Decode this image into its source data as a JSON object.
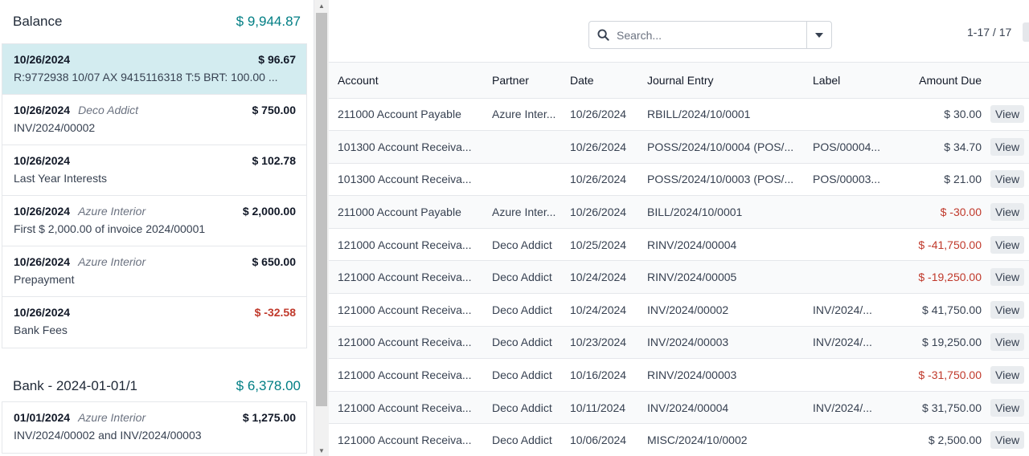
{
  "balance_group": {
    "title": "Balance",
    "amount": "$ 9,944.87"
  },
  "balance_lines": [
    {
      "date": "10/26/2024",
      "partner": "",
      "amount": "$ 96.67",
      "label": "R:9772938 10/07 AX 9415116318 T:5 BRT: 100.00 ...",
      "negative": false,
      "selected": true
    },
    {
      "date": "10/26/2024",
      "partner": "Deco Addict",
      "amount": "$ 750.00",
      "label": "INV/2024/00002",
      "negative": false
    },
    {
      "date": "10/26/2024",
      "partner": "",
      "amount": "$ 102.78",
      "label": "Last Year Interests",
      "negative": false
    },
    {
      "date": "10/26/2024",
      "partner": "Azure Interior",
      "amount": "$ 2,000.00",
      "label": "First $ 2,000.00 of invoice 2024/00001",
      "negative": false
    },
    {
      "date": "10/26/2024",
      "partner": "Azure Interior",
      "amount": "$ 650.00",
      "label": "Prepayment",
      "negative": false
    },
    {
      "date": "10/26/2024",
      "partner": "",
      "amount": "$ -32.58",
      "label": "Bank Fees",
      "negative": true
    }
  ],
  "bank_group": {
    "title": "Bank - 2024-01-01/1",
    "amount": "$ 6,378.00"
  },
  "bank_lines": [
    {
      "date": "01/01/2024",
      "partner": "Azure Interior",
      "amount": "$ 1,275.00",
      "label": "INV/2024/00002 and INV/2024/00003",
      "negative": false
    }
  ],
  "search": {
    "placeholder": "Search..."
  },
  "pager": {
    "text": "1-17 / 17"
  },
  "table": {
    "headers": [
      "Account",
      "Partner",
      "Date",
      "Journal Entry",
      "Label",
      "Amount Due"
    ],
    "view_label": "View",
    "rows": [
      {
        "account": "211000 Account Payable",
        "partner": "Azure Inter...",
        "date": "10/26/2024",
        "entry": "RBILL/2024/10/0001",
        "label": "",
        "amount": "$ 30.00",
        "negative": false
      },
      {
        "account": "101300 Account Receiva...",
        "partner": "",
        "date": "10/26/2024",
        "entry": "POSS/2024/10/0004 (POS/...",
        "label": "POS/00004...",
        "amount": "$ 34.70",
        "negative": false
      },
      {
        "account": "101300 Account Receiva...",
        "partner": "",
        "date": "10/26/2024",
        "entry": "POSS/2024/10/0003 (POS/...",
        "label": "POS/00003...",
        "amount": "$ 21.00",
        "negative": false
      },
      {
        "account": "211000 Account Payable",
        "partner": "Azure Inter...",
        "date": "10/26/2024",
        "entry": "BILL/2024/10/0001",
        "label": "",
        "amount": "$ -30.00",
        "negative": true
      },
      {
        "account": "121000 Account Receiva...",
        "partner": "Deco Addict",
        "date": "10/25/2024",
        "entry": "RINV/2024/00004",
        "label": "",
        "amount": "$ -41,750.00",
        "negative": true
      },
      {
        "account": "121000 Account Receiva...",
        "partner": "Deco Addict",
        "date": "10/24/2024",
        "entry": "RINV/2024/00005",
        "label": "",
        "amount": "$ -19,250.00",
        "negative": true
      },
      {
        "account": "121000 Account Receiva...",
        "partner": "Deco Addict",
        "date": "10/24/2024",
        "entry": "INV/2024/00002",
        "label": "INV/2024/...",
        "amount": "$ 41,750.00",
        "negative": false
      },
      {
        "account": "121000 Account Receiva...",
        "partner": "Deco Addict",
        "date": "10/23/2024",
        "entry": "INV/2024/00003",
        "label": "INV/2024/...",
        "amount": "$ 19,250.00",
        "negative": false
      },
      {
        "account": "121000 Account Receiva...",
        "partner": "Deco Addict",
        "date": "10/16/2024",
        "entry": "RINV/2024/00003",
        "label": "",
        "amount": "$ -31,750.00",
        "negative": true
      },
      {
        "account": "121000 Account Receiva...",
        "partner": "Deco Addict",
        "date": "10/11/2024",
        "entry": "INV/2024/00004",
        "label": "INV/2024/...",
        "amount": "$ 31,750.00",
        "negative": false
      },
      {
        "account": "121000 Account Receiva...",
        "partner": "Deco Addict",
        "date": "10/06/2024",
        "entry": "MISC/2024/10/0002",
        "label": "",
        "amount": "$ 2,500.00",
        "negative": false
      }
    ]
  },
  "colors": {
    "positive_group": "#017e84",
    "negative": "#c0392b",
    "selected_row": "#d3ecf0"
  },
  "icons": {
    "search": "search-icon",
    "dropdown": "caret-down-icon",
    "scroll_up": "scroll-up-arrow-icon",
    "scroll_down": "scroll-down-arrow-icon"
  }
}
